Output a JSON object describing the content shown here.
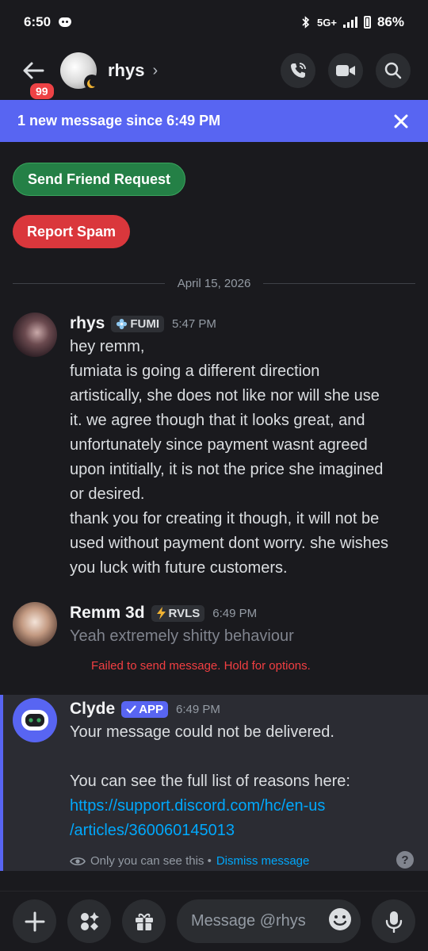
{
  "status": {
    "time": "6:50",
    "battery": "86%",
    "network": "5G+"
  },
  "header": {
    "badge_count": "99",
    "title": "rhys",
    "chevron": "›"
  },
  "banner": {
    "text": "1 new message since 6:49 PM",
    "close": "✕"
  },
  "actions": {
    "friend_request": "Send Friend Request",
    "report_spam": "Report Spam"
  },
  "divider": {
    "date": "April 15, 2026"
  },
  "messages": [
    {
      "author": "rhys",
      "tag": "FUMI",
      "time": "5:47 PM",
      "lines": [
        "hey remm,",
        "fumiata is going a different direction",
        "artistically, she does not like nor will she use",
        "it. we agree though that it looks great, and",
        "unfortunately since payment wasnt agreed",
        "upon intitially, it is not the price she imagined",
        "or desired.",
        "thank you for creating it though, it will not be",
        "used without payment dont worry. she wishes",
        "you luck with future customers."
      ]
    },
    {
      "author": "Remm 3d",
      "tag": "RVLS",
      "time": "6:49 PM",
      "text": "Yeah extremely shitty behaviour",
      "error": "Failed to send message. Hold for options."
    },
    {
      "author": "Clyde",
      "tag": "APP",
      "time": "6:49 PM",
      "line1": "Your message could not be delivered.",
      "line2": "You can see the full list of reasons here:",
      "link1": "https://support.discord.com/hc/en-us",
      "link2": "/articles/360060145013",
      "only_you": "Only you can see this •",
      "dismiss": "Dismiss message",
      "help": "?"
    }
  ],
  "composer": {
    "placeholder": "Message @rhys"
  },
  "colors": {
    "blurple": "#5865f2",
    "green": "#248046",
    "red": "#da373c",
    "link": "#00a8fc",
    "error": "#f23f42"
  }
}
